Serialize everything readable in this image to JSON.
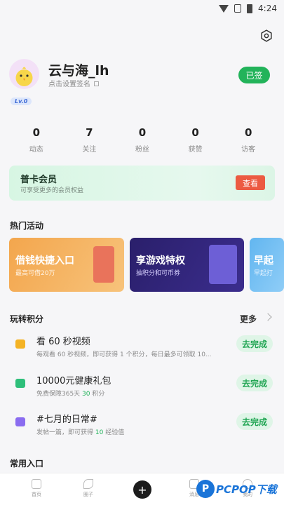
{
  "statusbar": {
    "time": "4:24"
  },
  "profile": {
    "username": "云与海_lh",
    "signature": "点击设置签名",
    "level": "Lv.0",
    "signed_label": "已签"
  },
  "stats": [
    {
      "value": "0",
      "label": "动态"
    },
    {
      "value": "7",
      "label": "关注"
    },
    {
      "value": "0",
      "label": "粉丝"
    },
    {
      "value": "0",
      "label": "获赞"
    },
    {
      "value": "0",
      "label": "访客"
    }
  ],
  "vip": {
    "title": "普卡会员",
    "subtitle": "可享受更多的会员权益",
    "button": "查看"
  },
  "hot": {
    "title": "热门活动",
    "banners": [
      {
        "title": "借钱快捷入口",
        "subtitle": "最高可借20万"
      },
      {
        "title": "享游戏特权",
        "subtitle": "抽积分和可币券"
      },
      {
        "title": "早起",
        "subtitle": "早起打"
      }
    ]
  },
  "points": {
    "title": "玩转积分",
    "more": "更多",
    "tasks": [
      {
        "title": "看 60 秒视频",
        "sub_pre": "每观看 60 秒视频，即可获得 1 个积分，每日最多可领取 10...",
        "sub_hl": "",
        "sub_post": "",
        "button": "去完成",
        "icon_color": "#f4b325"
      },
      {
        "title": "10000元健康礼包",
        "sub_pre": "免费保障365天 ",
        "sub_hl": "30",
        "sub_post": " 积分",
        "button": "去完成",
        "icon_color": "#2ebf7a"
      },
      {
        "title": "#七月的日常#",
        "sub_pre": "发帖一篇，即可获得 ",
        "sub_hl": "10",
        "sub_post": " 经验值",
        "button": "去完成",
        "icon_color": "#8a6cf0"
      }
    ]
  },
  "common": {
    "title": "常用入口"
  },
  "nav": {
    "items": [
      {
        "label": "首页"
      },
      {
        "label": "圈子"
      },
      {
        "label": "消息"
      },
      {
        "label": "我的"
      }
    ]
  },
  "watermark": {
    "logo": "P",
    "text": "PCPOP下载"
  }
}
